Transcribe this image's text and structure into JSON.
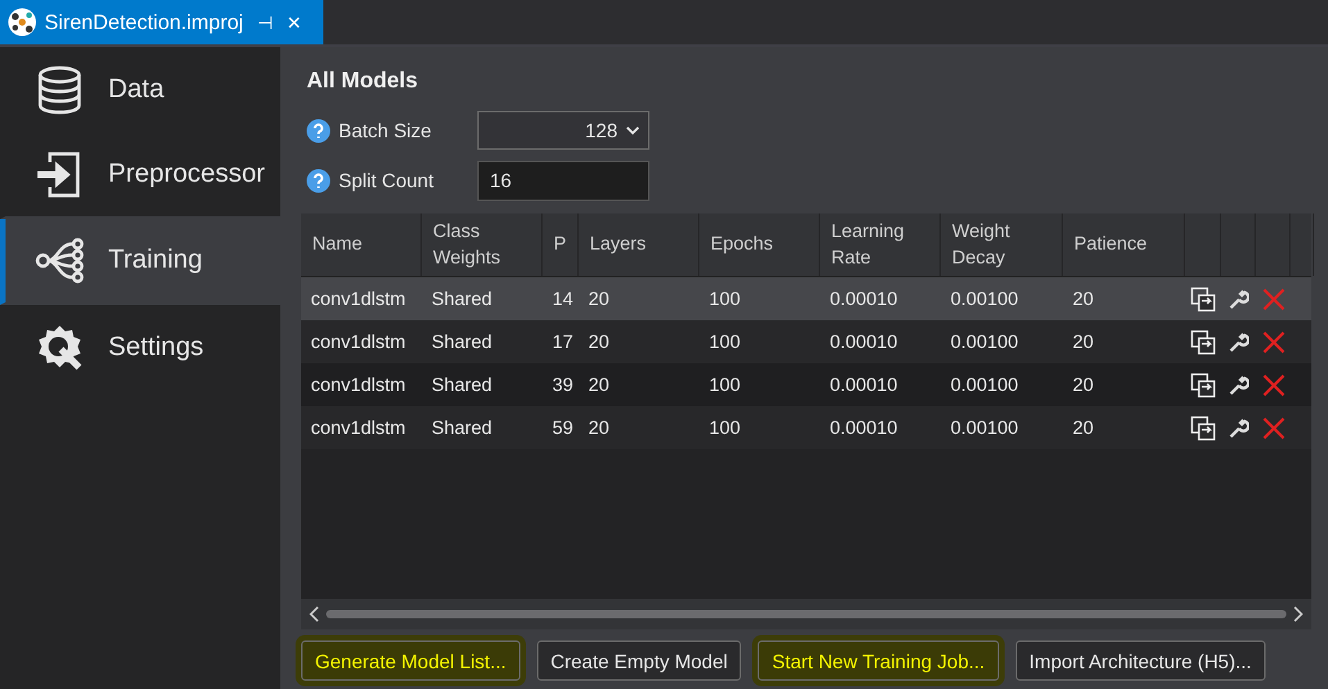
{
  "tab": {
    "title": "SirenDetection.improj",
    "pin": "⊣",
    "close": "✕"
  },
  "sidebar": {
    "items": [
      {
        "kind": "data",
        "label": "Data",
        "selected": false
      },
      {
        "kind": "preprocessor",
        "label": "Preprocessor",
        "selected": false
      },
      {
        "kind": "training",
        "label": "Training",
        "selected": true
      },
      {
        "kind": "settings",
        "label": "Settings",
        "selected": false
      }
    ]
  },
  "title": "All Models",
  "batch_size": {
    "label": "Batch Size",
    "value": "128"
  },
  "split_count": {
    "label": "Split Count",
    "value": "16"
  },
  "table": {
    "columns": [
      "Name",
      "Class Weights",
      "P",
      "Layers",
      "Epochs",
      "Learning Rate",
      "Weight Decay",
      "Patience"
    ],
    "rows": [
      {
        "selected": true,
        "cells": [
          "conv1dlstm",
          "Shared",
          "14",
          "20",
          "100",
          "0.00010",
          "0.00100",
          "20"
        ]
      },
      {
        "selected": false,
        "cells": [
          "conv1dlstm",
          "Shared",
          "17",
          "20",
          "100",
          "0.00010",
          "0.00100",
          "20"
        ]
      },
      {
        "selected": false,
        "cells": [
          "conv1dlstm",
          "Shared",
          "39",
          "20",
          "100",
          "0.00010",
          "0.00100",
          "20"
        ]
      },
      {
        "selected": false,
        "cells": [
          "conv1dlstm",
          "Shared",
          "59",
          "20",
          "100",
          "0.00010",
          "0.00100",
          "20"
        ]
      }
    ]
  },
  "buttons": [
    {
      "label": "Generate Model List...",
      "highlighted": true
    },
    {
      "label": "Create Empty Model",
      "highlighted": false
    },
    {
      "label": "Start New Training Job...",
      "highlighted": true
    },
    {
      "label": "Import Architecture (H5)...",
      "highlighted": false
    }
  ]
}
